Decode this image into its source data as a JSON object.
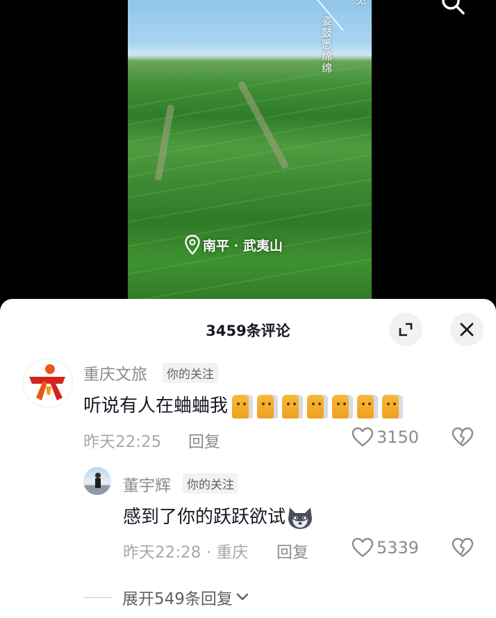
{
  "video": {
    "poem_line_1": "见",
    "poem_line_2": "姿鼓悉绵绵",
    "location": "南平 · 武夷山"
  },
  "sheet": {
    "title": "3459条评论"
  },
  "comments": [
    {
      "user": "重庆文旅",
      "badge": "你的关注",
      "text": "听说有人在蛐蛐我",
      "time": "昨天22:25",
      "reply_label": "回复",
      "likes": "3150"
    },
    {
      "user": "董宇辉",
      "badge": "你的关注",
      "text": "感到了你的跃跃欲试",
      "time": "昨天22:28 · 重庆",
      "reply_label": "回复",
      "likes": "5339"
    }
  ],
  "expand": {
    "label": "展开549条回复"
  },
  "icons": [
    "search-icon",
    "expand-icon",
    "close-icon",
    "location-pin-icon",
    "heart-icon",
    "broken-heart-icon",
    "chevron-down-icon",
    "cat-emoji-icon",
    "husky-emoji-icon"
  ]
}
